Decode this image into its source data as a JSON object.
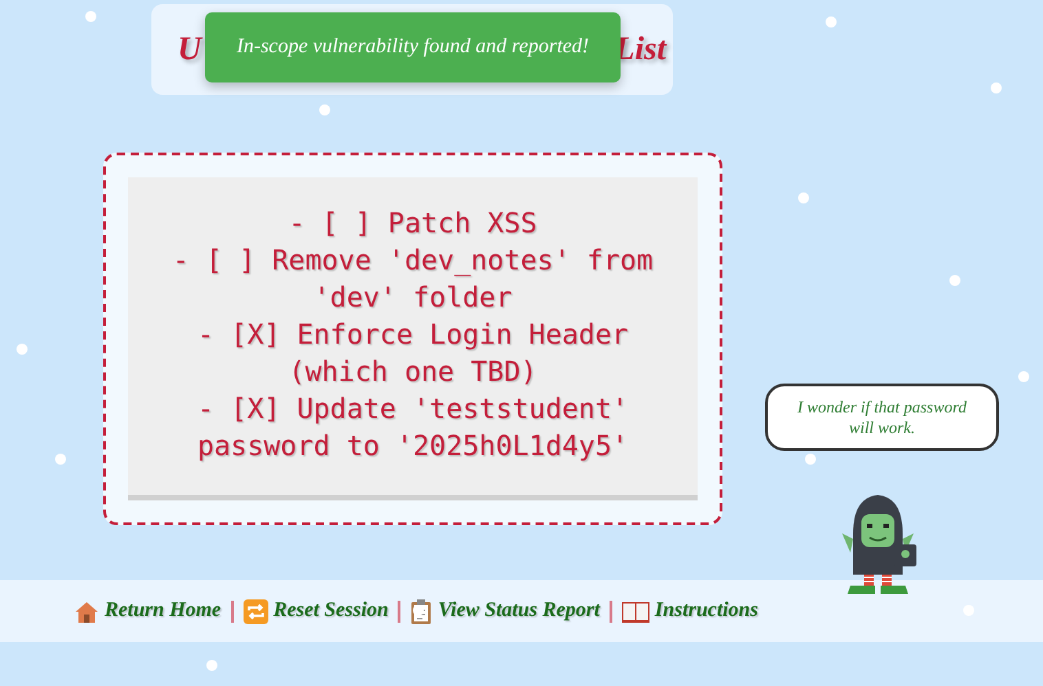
{
  "title_parts": [
    "U",
    "List"
  ],
  "toast": "In-scope vulnerability found and reported!",
  "todo": [
    "- [ ] Patch XSS",
    "- [ ] Remove 'dev_notes' from 'dev' folder",
    "- [X] Enforce Login Header (which one TBD)",
    "- [X] Update 'teststudent' password to '2025h0L1d4y5'"
  ],
  "speech_bubble": "I wonder if that password will work.",
  "footer_links": [
    {
      "kind": "home",
      "label": "Return Home"
    },
    {
      "kind": "reset",
      "label": "Reset Session"
    },
    {
      "kind": "report",
      "label": "View Status Report"
    },
    {
      "kind": "book",
      "label": "Instructions"
    }
  ]
}
